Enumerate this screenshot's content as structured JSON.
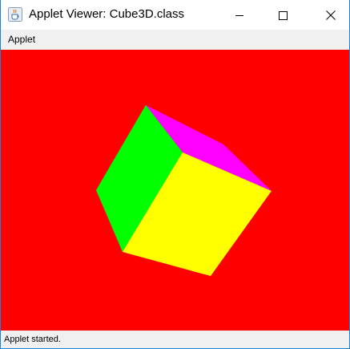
{
  "window": {
    "title": "Applet Viewer: Cube3D.class",
    "icon": "java-cup-icon",
    "controls": [
      "minimize-icon",
      "maximize-icon",
      "close-icon"
    ]
  },
  "menubar": {
    "items": [
      {
        "label": "Applet"
      }
    ]
  },
  "canvas": {
    "background": "#ff0000",
    "faces": [
      {
        "name": "front",
        "color": "#ffff00"
      },
      {
        "name": "left",
        "color": "#00ff00"
      },
      {
        "name": "top",
        "color": "#ff00ff"
      }
    ]
  },
  "status": {
    "text": "Applet started."
  }
}
